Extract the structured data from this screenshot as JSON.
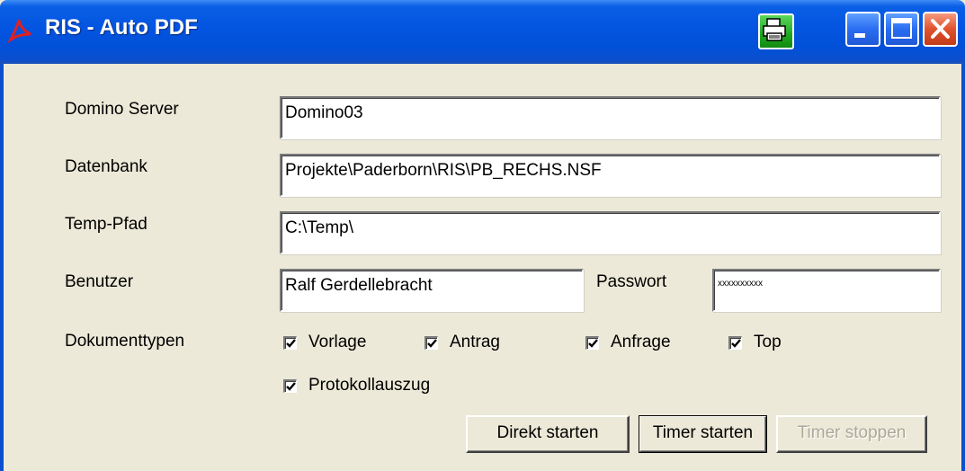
{
  "window": {
    "title": "RIS - Auto PDF",
    "icon": "pdf-icon",
    "controls": {
      "printer": "printer-icon",
      "minimize": "minimize-icon",
      "maximize": "maximize-icon",
      "close": "close-icon"
    }
  },
  "form": {
    "server": {
      "label": "Domino Server",
      "value": "Domino03"
    },
    "database": {
      "label": "Datenbank",
      "value": "Projekte\\Paderborn\\RIS\\PB_RECHS.NSF"
    },
    "temp": {
      "label": "Temp-Pfad",
      "value": "C:\\Temp\\"
    },
    "user": {
      "label": "Benutzer",
      "value": "Ralf Gerdellebracht"
    },
    "password": {
      "label": "Passwort",
      "value": "xxxxxxxxxx"
    },
    "doctypes": {
      "label": "Dokumenttypen",
      "items": [
        {
          "label": "Vorlage",
          "checked": true
        },
        {
          "label": "Antrag",
          "checked": true
        },
        {
          "label": "Anfrage",
          "checked": true
        },
        {
          "label": "Top",
          "checked": true
        },
        {
          "label": "Protokollauszug",
          "checked": true
        }
      ]
    }
  },
  "buttons": {
    "direct": "Direkt starten",
    "timer_start": "Timer starten",
    "timer_stop": "Timer stoppen"
  },
  "colors": {
    "titlebar": "#0354e0",
    "face": "#ece9d8",
    "disabled_text": "#aca899"
  }
}
